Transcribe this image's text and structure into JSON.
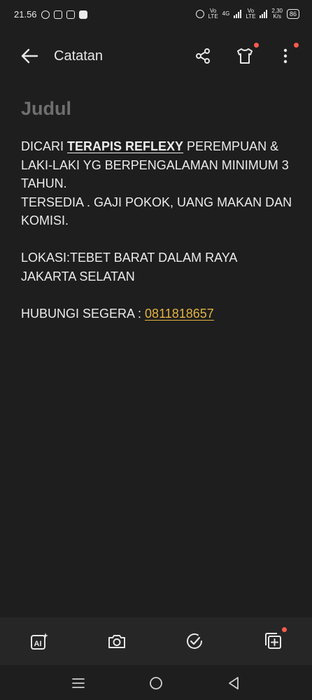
{
  "status_bar": {
    "time": "21.56",
    "network1": "Vo\nLTE",
    "network2": "4G",
    "network3": "Vo\nLTE",
    "speed": "2,30\nK/s",
    "battery": "86"
  },
  "app_bar": {
    "title": "Catatan"
  },
  "note": {
    "title_placeholder": "Judul",
    "line1_prefix": "DICARI ",
    "line1_bold": "TERAPIS REFLEXY",
    "line1_suffix": " PEREMPUAN & LAKI-LAKI YG BERPENGALAMAN MINIMUM 3 TAHUN.",
    "line2": "TERSEDIA . GAJI POKOK, UANG MAKAN DAN KOMISI.",
    "line3": "LOKASI:TEBET BARAT DALAM RAYA JAKARTA SELATAN",
    "line4_prefix": "HUBUNGI SEGERA : ",
    "line4_phone": "0811818657"
  },
  "icons": {
    "back": "arrow-left-icon",
    "share": "share-icon",
    "skin": "tshirt-icon",
    "more": "more-vertical-icon",
    "ai": "ai-icon",
    "camera": "camera-icon",
    "checklist": "check-circle-icon",
    "add_note": "add-note-icon"
  },
  "colors": {
    "background": "#1e1e1e",
    "toolbar": "#262626",
    "link": "#e3b341",
    "badge": "#ff5a4f"
  }
}
